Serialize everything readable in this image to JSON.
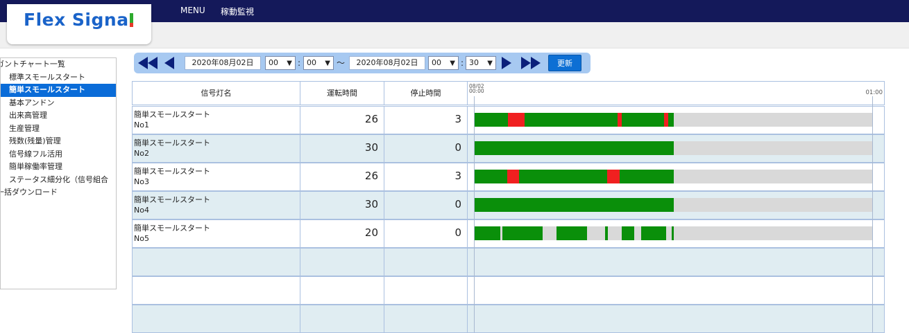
{
  "header": {
    "logo": "Flex Signal",
    "nav": [
      "MENU",
      "稼動監視"
    ]
  },
  "sidebar": {
    "items": [
      {
        "label": "ガントチャート一覧",
        "level": "top",
        "active": false
      },
      {
        "label": "標準スモールスタート",
        "level": "sub",
        "active": false
      },
      {
        "label": "簡単スモールスタート",
        "level": "sub",
        "active": true
      },
      {
        "label": "基本アンドン",
        "level": "sub",
        "active": false
      },
      {
        "label": "出来高管理",
        "level": "sub",
        "active": false
      },
      {
        "label": "生産管理",
        "level": "sub",
        "active": false
      },
      {
        "label": "残数(残量)管理",
        "level": "sub",
        "active": false
      },
      {
        "label": "信号線フル活用",
        "level": "sub",
        "active": false
      },
      {
        "label": "簡単稼働率管理",
        "level": "sub",
        "active": false
      },
      {
        "label": "ステータス細分化（信号組合",
        "level": "sub",
        "active": false
      },
      {
        "label": "一括ダウンロード",
        "level": "top",
        "active": false
      }
    ]
  },
  "toolbar": {
    "start_date": "2020年08月02日",
    "start_hour": "00",
    "start_min": "00",
    "tilde": "～",
    "colon": ":",
    "end_date": "2020年08月02日",
    "end_hour": "00",
    "end_min": "30",
    "update_label": "更新"
  },
  "table": {
    "headers": [
      "信号灯名",
      "運転時間",
      "停止時間"
    ],
    "timeline_start_date": "08/02",
    "timeline_start_time": "00:00",
    "timeline_end_time": "01:00",
    "timeline_minutes": 60,
    "colors": {
      "run": "#0a8f0a",
      "stop": "#f02020",
      "idle": "#d9d9d9"
    },
    "rows": [
      {
        "name": "簡単スモールスタート",
        "id": "No1",
        "run": "26",
        "stop": "3",
        "segments": [
          [
            "run",
            0,
            5
          ],
          [
            "stop",
            5,
            7.5
          ],
          [
            "run",
            7.5,
            21.5
          ],
          [
            "stop",
            21.5,
            22.2
          ],
          [
            "run",
            22.2,
            28.5
          ],
          [
            "stop",
            28.5,
            29.2
          ],
          [
            "run",
            29.2,
            30
          ]
        ]
      },
      {
        "name": "簡単スモールスタート",
        "id": "No2",
        "run": "30",
        "stop": "0",
        "segments": [
          [
            "run",
            0,
            30
          ]
        ]
      },
      {
        "name": "簡単スモールスタート",
        "id": "No3",
        "run": "26",
        "stop": "3",
        "segments": [
          [
            "run",
            0,
            4.9
          ],
          [
            "stop",
            4.9,
            6.7
          ],
          [
            "run",
            6.7,
            20
          ],
          [
            "stop",
            20,
            21.8
          ],
          [
            "run",
            21.8,
            30
          ]
        ]
      },
      {
        "name": "簡単スモールスタート",
        "id": "No4",
        "run": "30",
        "stop": "0",
        "segments": [
          [
            "run",
            0,
            30
          ]
        ]
      },
      {
        "name": "簡単スモールスタート",
        "id": "No5",
        "run": "20",
        "stop": "0",
        "segments": [
          [
            "run",
            0,
            3.9
          ],
          [
            "run",
            4.2,
            10.2
          ],
          [
            "run",
            12.3,
            16.9
          ],
          [
            "run",
            19.7,
            20.1
          ],
          [
            "run",
            22.2,
            24
          ],
          [
            "run",
            25.1,
            28.8
          ],
          [
            "run",
            29.7,
            30
          ]
        ]
      },
      {
        "name": "",
        "id": "",
        "run": "",
        "stop": "",
        "segments": []
      },
      {
        "name": "",
        "id": "",
        "run": "",
        "stop": "",
        "segments": []
      },
      {
        "name": "",
        "id": "",
        "run": "",
        "stop": "",
        "segments": []
      }
    ]
  }
}
